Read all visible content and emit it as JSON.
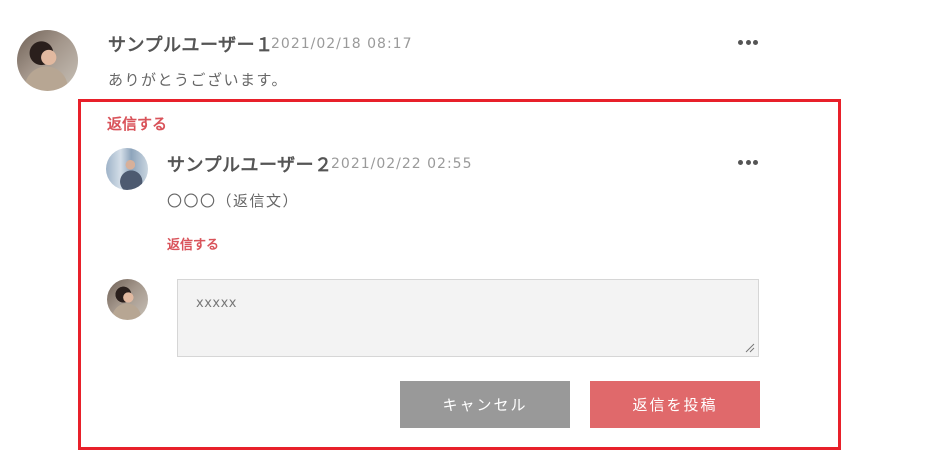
{
  "colors": {
    "accent": "#d9535a",
    "submit_button": "#e0696b",
    "cancel_button": "#999999",
    "highlight_border": "#e8202a"
  },
  "comment": {
    "username": "サンプルユーザー１",
    "timestamp": "2021/02/18 08:17",
    "body": "ありがとうございます。",
    "more_icon": "more-horizontal-icon"
  },
  "reply_section": {
    "reply_link": "返信する",
    "reply": {
      "username": "サンプルユーザー２",
      "timestamp": "2021/02/22 02:55",
      "body": "〇〇〇（返信文）",
      "reply_link": "返信する",
      "more_icon": "more-horizontal-icon"
    },
    "form": {
      "textarea_value": "xxxxx",
      "cancel_label": "キャンセル",
      "submit_label": "返信を投稿"
    }
  }
}
